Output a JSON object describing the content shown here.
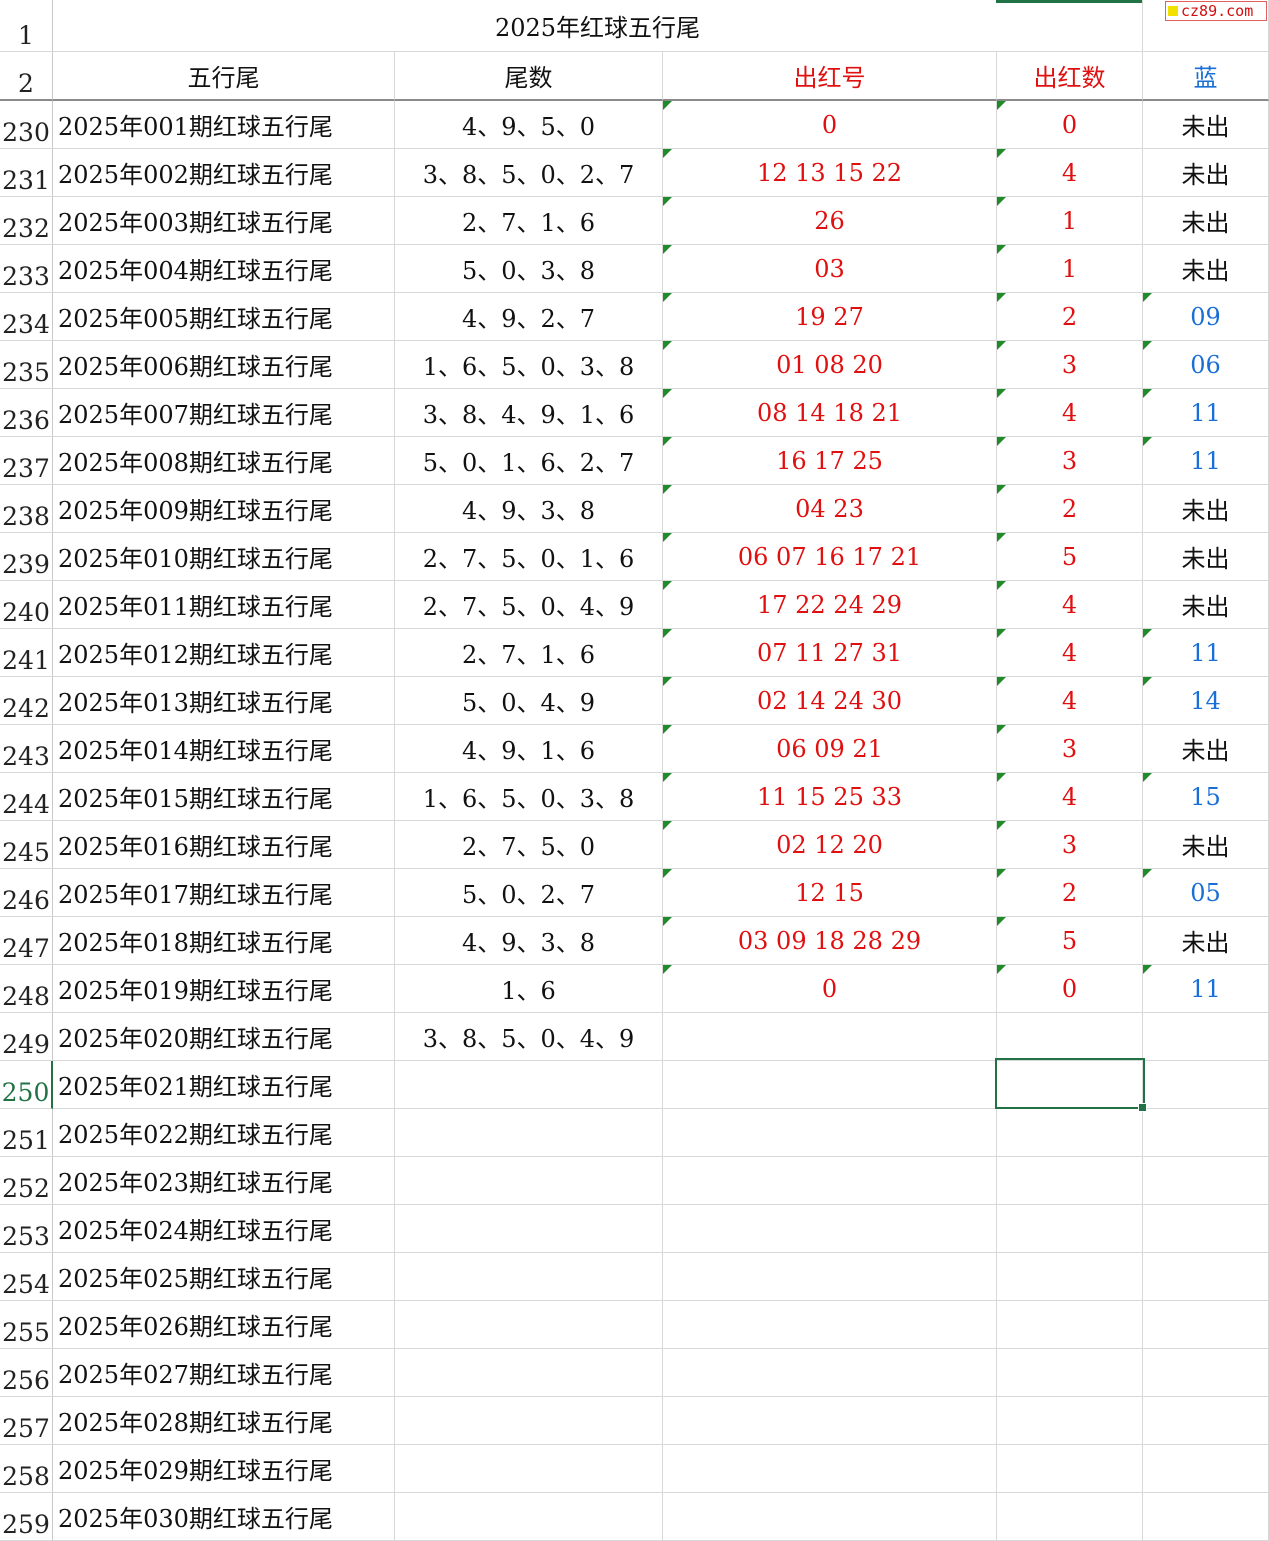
{
  "watermark": "cz89.com",
  "title_row": {
    "row_num": "1",
    "title": "2025年红球五行尾"
  },
  "header_row": {
    "row_num": "2",
    "cols": [
      "五行尾",
      "尾数",
      "出红号",
      "出红数",
      "蓝"
    ]
  },
  "colors": {
    "red": "#e01010",
    "blue": "#1a6fd6",
    "select": "#217346",
    "flag": "#1f8a2a"
  },
  "rows": [
    {
      "num": "230",
      "name": "2025年001期红球五行尾",
      "tail": "4、9、5、0",
      "red": "0",
      "count": "0",
      "blue": "未出"
    },
    {
      "num": "231",
      "name": "2025年002期红球五行尾",
      "tail": "3、8、5、0、2、7",
      "red": "12  13  15  22",
      "count": "4",
      "blue": "未出"
    },
    {
      "num": "232",
      "name": "2025年003期红球五行尾",
      "tail": "2、7、1、6",
      "red": "26",
      "count": "1",
      "blue": "未出"
    },
    {
      "num": "233",
      "name": "2025年004期红球五行尾",
      "tail": "5、0、3、8",
      "red": "03",
      "count": "1",
      "blue": "未出"
    },
    {
      "num": "234",
      "name": "2025年005期红球五行尾",
      "tail": "4、9、2、7",
      "red": "19  27",
      "count": "2",
      "blue": "09"
    },
    {
      "num": "235",
      "name": "2025年006期红球五行尾",
      "tail": "1、6、5、0、3、8",
      "red": "01  08  20",
      "count": "3",
      "blue": "06"
    },
    {
      "num": "236",
      "name": "2025年007期红球五行尾",
      "tail": "3、8、4、9、1、6",
      "red": "08  14  18  21",
      "count": "4",
      "blue": "11"
    },
    {
      "num": "237",
      "name": "2025年008期红球五行尾",
      "tail": "5、0、1、6、2、7",
      "red": "16  17  25",
      "count": "3",
      "blue": "11"
    },
    {
      "num": "238",
      "name": "2025年009期红球五行尾",
      "tail": "4、9、3、8",
      "red": "04  23",
      "count": "2",
      "blue": "未出"
    },
    {
      "num": "239",
      "name": "2025年010期红球五行尾",
      "tail": "2、7、5、0、1、6",
      "red": "06  07  16  17  21",
      "count": "5",
      "blue": "未出"
    },
    {
      "num": "240",
      "name": "2025年011期红球五行尾",
      "tail": "2、7、5、0、4、9",
      "red": "17  22  24  29",
      "count": "4",
      "blue": "未出"
    },
    {
      "num": "241",
      "name": "2025年012期红球五行尾",
      "tail": "2、7、1、6",
      "red": "07  11  27  31",
      "count": "4",
      "blue": "11"
    },
    {
      "num": "242",
      "name": "2025年013期红球五行尾",
      "tail": "5、0、4、9",
      "red": "02  14  24  30",
      "count": "4",
      "blue": "14"
    },
    {
      "num": "243",
      "name": "2025年014期红球五行尾",
      "tail": "4、9、1、6",
      "red": "06  09  21",
      "count": "3",
      "blue": "未出"
    },
    {
      "num": "244",
      "name": "2025年015期红球五行尾",
      "tail": "1、6、5、0、3、8",
      "red": "11  15  25  33",
      "count": "4",
      "blue": "15"
    },
    {
      "num": "245",
      "name": "2025年016期红球五行尾",
      "tail": "2、7、5、0",
      "red": "02  12  20",
      "count": "3",
      "blue": "未出"
    },
    {
      "num": "246",
      "name": "2025年017期红球五行尾",
      "tail": "5、0、2、7",
      "red": "12  15",
      "count": "2",
      "blue": "05"
    },
    {
      "num": "247",
      "name": "2025年018期红球五行尾",
      "tail": "4、9、3、8",
      "red": "03  09  18  28  29",
      "count": "5",
      "blue": "未出"
    },
    {
      "num": "248",
      "name": "2025年019期红球五行尾",
      "tail": "1、6",
      "red": "0",
      "count": "0",
      "blue": "11"
    },
    {
      "num": "249",
      "name": "2025年020期红球五行尾",
      "tail": "3、8、5、0、4、9",
      "red": "",
      "count": "",
      "blue": ""
    },
    {
      "num": "250",
      "name": "2025年021期红球五行尾",
      "tail": "",
      "red": "",
      "count": "",
      "blue": ""
    },
    {
      "num": "251",
      "name": "2025年022期红球五行尾",
      "tail": "",
      "red": "",
      "count": "",
      "blue": ""
    },
    {
      "num": "252",
      "name": "2025年023期红球五行尾",
      "tail": "",
      "red": "",
      "count": "",
      "blue": ""
    },
    {
      "num": "253",
      "name": "2025年024期红球五行尾",
      "tail": "",
      "red": "",
      "count": "",
      "blue": ""
    },
    {
      "num": "254",
      "name": "2025年025期红球五行尾",
      "tail": "",
      "red": "",
      "count": "",
      "blue": ""
    },
    {
      "num": "255",
      "name": "2025年026期红球五行尾",
      "tail": "",
      "red": "",
      "count": "",
      "blue": ""
    },
    {
      "num": "256",
      "name": "2025年027期红球五行尾",
      "tail": "",
      "red": "",
      "count": "",
      "blue": ""
    },
    {
      "num": "257",
      "name": "2025年028期红球五行尾",
      "tail": "",
      "red": "",
      "count": "",
      "blue": ""
    },
    {
      "num": "258",
      "name": "2025年029期红球五行尾",
      "tail": "",
      "red": "",
      "count": "",
      "blue": ""
    },
    {
      "num": "259",
      "name": "2025年030期红球五行尾",
      "tail": "",
      "red": "",
      "count": "",
      "blue": ""
    }
  ]
}
